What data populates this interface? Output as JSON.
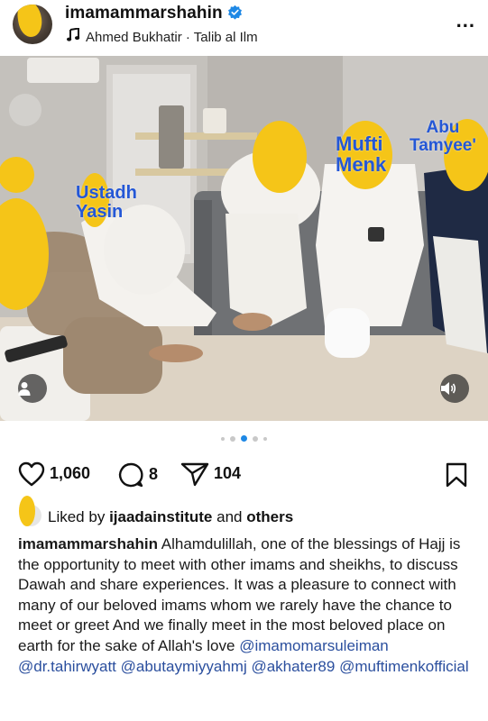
{
  "post": {
    "username": "imamammarshahin",
    "audio": "Ahmed Bukhatir · Talib al Ilm",
    "more_label": "...",
    "photo_labels": {
      "ustadh": "Ustadh\nYasin",
      "mufti": "Mufti\nMenk",
      "abu": "Abu\nTamyee'"
    },
    "counts": {
      "likes": "1,060",
      "comments": "8",
      "shares": "104"
    },
    "liked_by": {
      "prefix": "Liked by",
      "user": "ijaadainstitute",
      "and": "and",
      "others": "others"
    },
    "caption": {
      "username": "imamammarshahin",
      "text": "Alhamdulillah, one of the blessings of Hajj is the opportunity to meet with other imams and sheikhs, to discuss Dawah and share experiences. It was a pleasure to connect with many of our beloved imams whom we rarely have the chance to meet or greet And we finally meet in the most beloved place on earth for the sake of Allah's love",
      "mentions": [
        "@imamomarsuleiman",
        "@dr.tahirwyatt",
        "@abutaymiyyahmj",
        "@akhater89",
        "@muftimenkofficial"
      ]
    },
    "carousel": {
      "count": 5,
      "active": 3
    },
    "colors": {
      "accent": "#1e88e5",
      "label_blue": "#2457d6",
      "blob_yellow": "#f5c518"
    },
    "icons": [
      "verified-badge-icon",
      "music-note-icon",
      "more-icon",
      "user-tag-icon",
      "speaker-icon",
      "heart-icon",
      "comment-icon",
      "share-icon",
      "bookmark-icon"
    ]
  }
}
